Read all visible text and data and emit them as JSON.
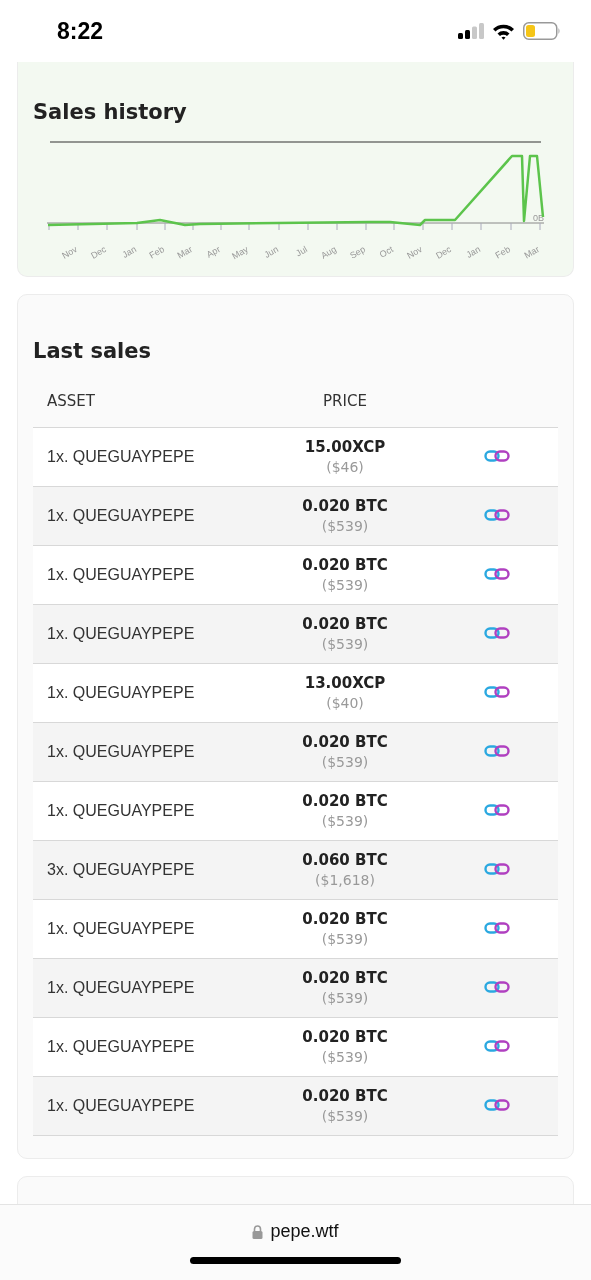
{
  "status_bar": {
    "time": "8:22"
  },
  "sales_history": {
    "title": "Sales history",
    "x_labels": [
      "Nov",
      "Dec",
      "Jan",
      "Feb",
      "Mar",
      "Apr",
      "May",
      "Jun",
      "Jul",
      "Aug",
      "Sep",
      "Oct",
      "Nov",
      "Dec",
      "Jan",
      "Feb",
      "Mar"
    ],
    "y_label": "0B"
  },
  "last_sales": {
    "title": "Last sales",
    "columns": [
      "ASSET",
      "PRICE"
    ],
    "rows": [
      {
        "asset": "1x. QUEGUAYPEPE",
        "price": "15.00XCP",
        "usd": "($46)"
      },
      {
        "asset": "1x. QUEGUAYPEPE",
        "price": "0.020 BTC",
        "usd": "($539)"
      },
      {
        "asset": "1x. QUEGUAYPEPE",
        "price": "0.020 BTC",
        "usd": "($539)"
      },
      {
        "asset": "1x. QUEGUAYPEPE",
        "price": "0.020 BTC",
        "usd": "($539)"
      },
      {
        "asset": "1x. QUEGUAYPEPE",
        "price": "13.00XCP",
        "usd": "($40)"
      },
      {
        "asset": "1x. QUEGUAYPEPE",
        "price": "0.020 BTC",
        "usd": "($539)"
      },
      {
        "asset": "1x. QUEGUAYPEPE",
        "price": "0.020 BTC",
        "usd": "($539)"
      },
      {
        "asset": "3x. QUEGUAYPEPE",
        "price": "0.060 BTC",
        "usd": "($1,618)"
      },
      {
        "asset": "1x. QUEGUAYPEPE",
        "price": "0.020 BTC",
        "usd": "($539)"
      },
      {
        "asset": "1x. QUEGUAYPEPE",
        "price": "0.020 BTC",
        "usd": "($539)"
      },
      {
        "asset": "1x. QUEGUAYPEPE",
        "price": "0.020 BTC",
        "usd": "($539)"
      },
      {
        "asset": "1x. QUEGUAYPEPE",
        "price": "0.020 BTC",
        "usd": "($539)"
      }
    ]
  },
  "browser": {
    "url": "pepe.wtf"
  }
}
